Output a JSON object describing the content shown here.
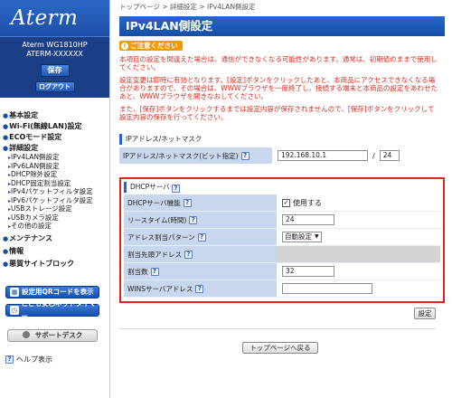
{
  "brand": {
    "logo": "Aterm",
    "model_line1": "Aterm WG1810HP",
    "model_line2": "ATERM-XXXXXX"
  },
  "sidebar": {
    "save_label": "保存",
    "logout_label": "ログアウト",
    "nav": [
      {
        "label": "基本設定"
      },
      {
        "label": "Wi-Fi(無線LAN)設定"
      },
      {
        "label": "ECOモード設定"
      },
      {
        "label": "詳細設定"
      }
    ],
    "sub_nav": [
      "IPv4LAN側設定",
      "IPv6LAN側設定",
      "DHCP除外設定",
      "DHCP固定割当設定",
      "IPv4パケットフィルタ設定",
      "IPv6パケットフィルタ設定",
      "USBストレージ設定",
      "USBカメラ設定",
      "その他の設定"
    ],
    "nav_bottom": [
      {
        "label": "メンテナンス"
      },
      {
        "label": "情報"
      },
      {
        "label": "悪質サイトブロック"
      }
    ],
    "qr_button": "設定用QRコードを表示",
    "timer_button": "こども安心ネットタイマー",
    "support_button": "サポートデスク",
    "help_label": "ヘルプ表示"
  },
  "breadcrumb": [
    "トップページ",
    "詳細設定",
    "IPv4LAN側設定"
  ],
  "breadcrumb_sep": ">",
  "page_title": "IPv4LAN側設定",
  "caution": {
    "badge": "ご注意ください",
    "lines": [
      "本項目の設定を間違えた場合は、通信ができなくなる可能性があります。通常は、初期値のままで使用してください。",
      "設定変更は即時に有効となります。[設定]ボタンをクリックしたあと、本商品にアクセスできなくなる場合がありますので、その場合は、WWWブラウザを一度終了し、接続する端末と本商品の設定をあわせたあと、WWWブラウザを開きなおしてください。",
      "また、[保存]ボタンをクリックするまでは設定内容が保存されませんので、[保存]ボタンをクリックして設定内容の保存を行ってください。"
    ]
  },
  "ip_section": {
    "heading": "IPアドレス/ネットマスク",
    "row_label": "IPアドレス/ネットマスク(ビット指定)",
    "ip_value": "192.168.10.1",
    "slash": "/",
    "mask_value": "24"
  },
  "dhcp_section": {
    "heading": "DHCPサーバ",
    "rows": {
      "dhcp_server_label": "DHCPサーバ機能",
      "dhcp_server_check": "✓",
      "dhcp_server_text": "使用する",
      "lease_label": "リースタイム(時間)",
      "lease_value": "24",
      "assign_label": "アドレス割当パターン",
      "assign_value": "自動設定",
      "start_label": "割当先頭アドレス",
      "count_label": "割当数",
      "count_value": "32",
      "wins_label": "WINSサーバアドレス",
      "wins_value": ""
    }
  },
  "buttons": {
    "setting": "設定",
    "top_page": "トップページへ戻る"
  },
  "colors": {
    "title_bar": "#1f5cbf",
    "warning_text": "#d62b1f",
    "caution_badge": "#f39800",
    "highlight_border": "#e6211d",
    "label_bg": "#c9d7ee"
  }
}
